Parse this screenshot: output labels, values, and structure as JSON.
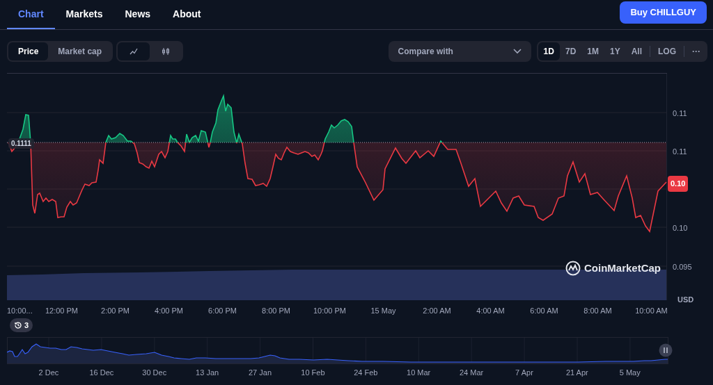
{
  "nav_tabs": [
    {
      "label": "Chart",
      "selected": true
    },
    {
      "label": "Markets",
      "selected": false
    },
    {
      "label": "News",
      "selected": false
    },
    {
      "label": "About",
      "selected": false
    }
  ],
  "buy_button": "Buy CHILLGUY",
  "metric_toggle": [
    {
      "label": "Price",
      "selected": true
    },
    {
      "label": "Market cap",
      "selected": false
    }
  ],
  "chart_type_toggle": [
    {
      "kind": "line",
      "selected": true
    },
    {
      "kind": "candles",
      "selected": false
    }
  ],
  "compare": {
    "placeholder": "Compare with"
  },
  "ranges": [
    {
      "label": "1D",
      "selected": true
    },
    {
      "label": "7D",
      "selected": false
    },
    {
      "label": "1M",
      "selected": false
    },
    {
      "label": "1Y",
      "selected": false
    },
    {
      "label": "All",
      "selected": false
    }
  ],
  "log_button": "LOG",
  "more_button": "···",
  "price_chart": {
    "reference_price": "0.1111",
    "current_price": "0.10",
    "y_axis_labels": [
      "0.11",
      "0.11",
      "0.10",
      "0.095"
    ],
    "currency": "USD",
    "logo_text": "CoinMarketCap",
    "x_axis_labels": [
      "10:00...",
      "12:00 PM",
      "2:00 PM",
      "4:00 PM",
      "6:00 PM",
      "8:00 PM",
      "10:00 PM",
      "15 May",
      "2:00 AM",
      "4:00 AM",
      "6:00 AM",
      "8:00 AM",
      "10:00 AM"
    ]
  },
  "history_badge": {
    "count": "3"
  },
  "navigator": {
    "dates": [
      "2 Dec",
      "16 Dec",
      "30 Dec",
      "13 Jan",
      "27 Jan",
      "10 Feb",
      "24 Feb",
      "10 Mar",
      "24 Mar",
      "7 Apr",
      "21 Apr",
      "5 May"
    ]
  }
}
